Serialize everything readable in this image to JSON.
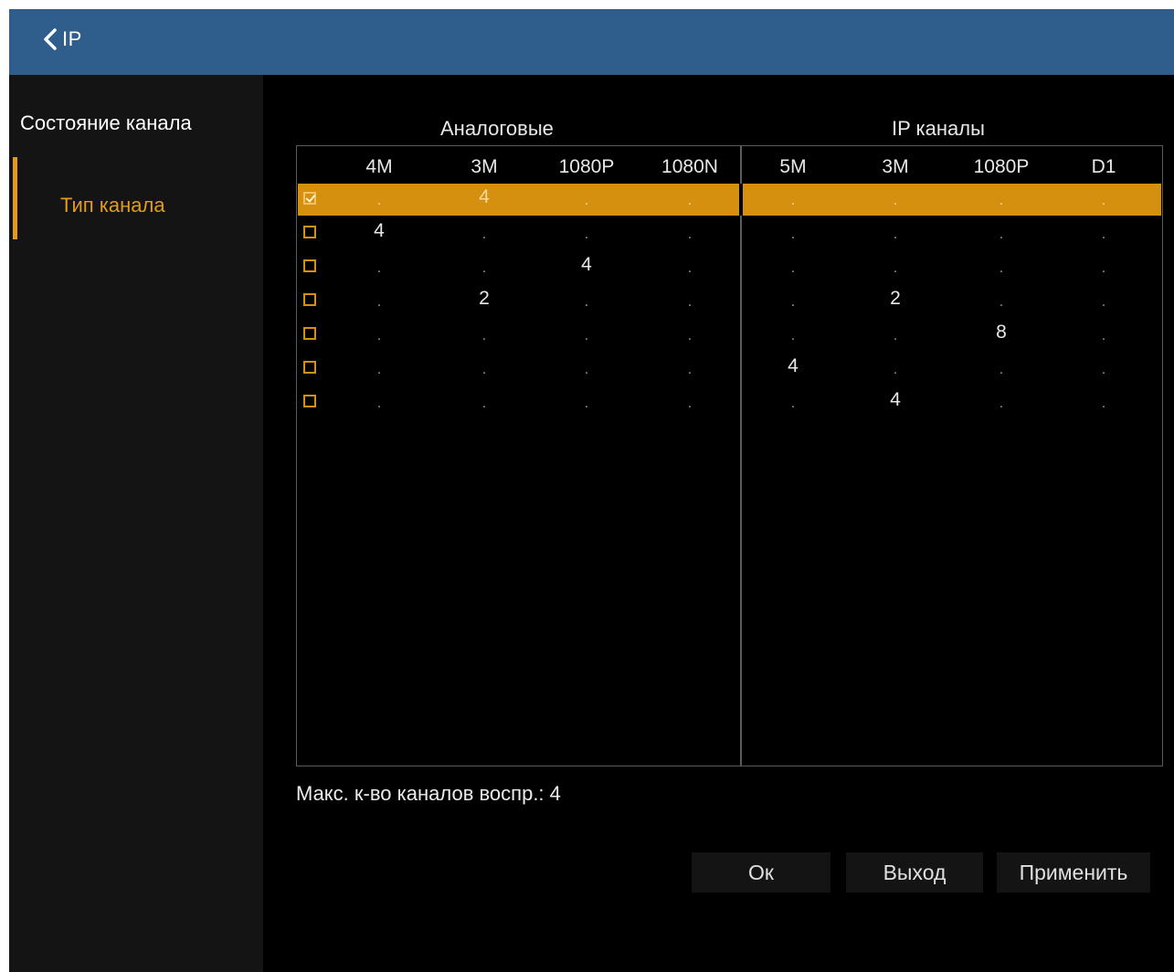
{
  "header": {
    "title": "IP"
  },
  "sidebar": {
    "section": "Состояние канала",
    "items": [
      {
        "label": "Тип канала"
      }
    ]
  },
  "groups": {
    "analog": "Аналоговые",
    "ip": "IP каналы"
  },
  "columns": [
    "4M",
    "3M",
    "1080P",
    "1080N",
    "5M",
    "3M",
    "1080P",
    "D1"
  ],
  "rows": [
    {
      "checked": true,
      "values": [
        ".",
        "4",
        ".",
        ".",
        ".",
        ".",
        ".",
        "."
      ]
    },
    {
      "checked": false,
      "values": [
        "4",
        ".",
        ".",
        ".",
        ".",
        ".",
        ".",
        "."
      ]
    },
    {
      "checked": false,
      "values": [
        ".",
        ".",
        "4",
        ".",
        ".",
        ".",
        ".",
        "."
      ]
    },
    {
      "checked": false,
      "values": [
        ".",
        "2",
        ".",
        ".",
        ".",
        "2",
        ".",
        "."
      ]
    },
    {
      "checked": false,
      "values": [
        ".",
        ".",
        ".",
        ".",
        ".",
        ".",
        "8",
        "."
      ]
    },
    {
      "checked": false,
      "values": [
        ".",
        ".",
        ".",
        ".",
        "4",
        ".",
        ".",
        "."
      ]
    },
    {
      "checked": false,
      "values": [
        ".",
        ".",
        ".",
        ".",
        ".",
        "4",
        ".",
        "."
      ]
    }
  ],
  "footer": {
    "max_playback": "Макс. к-во каналов воспр.: 4"
  },
  "buttons": {
    "ok": "Ок",
    "exit": "Выход",
    "apply": "Применить"
  },
  "colors": {
    "header_bg": "#2f5d8c",
    "accent": "#e49a1e",
    "highlight_row": "#d6900f"
  }
}
